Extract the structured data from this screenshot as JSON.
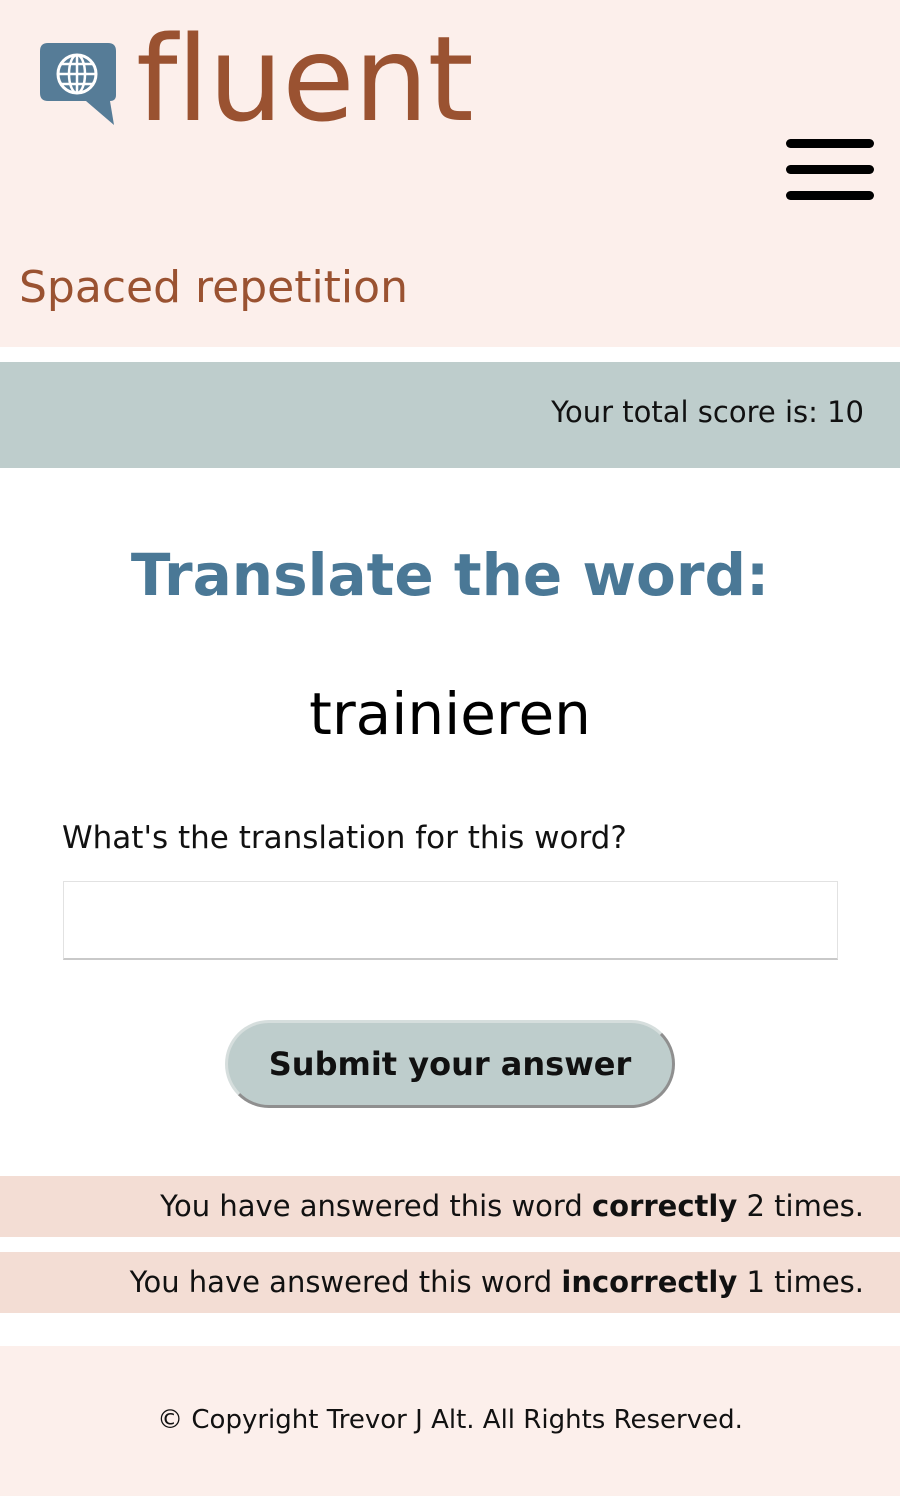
{
  "header": {
    "brand": "fluent",
    "page_subtitle": "Spaced repetition",
    "logo_icon": "globe-speech-bubble-icon",
    "menu_icon": "hamburger-menu-icon"
  },
  "score": {
    "text": "Your total score is: 10"
  },
  "quiz": {
    "heading": "Translate the word:",
    "word": "trainieren",
    "field_label": "What's the translation for this word?",
    "input_value": "",
    "submit_label": "Submit your answer"
  },
  "stats": {
    "correct_prefix": "You have answered this word",
    "correct_keyword": "correctly",
    "correct_suffix": "2 times.",
    "incorrect_prefix": "You have answered this word",
    "incorrect_keyword": "incorrectly",
    "incorrect_suffix": "1 times."
  },
  "footer": {
    "copyright": "© Copyright Trevor J Alt. All Rights Reserved."
  },
  "colors": {
    "header_bg": "#fcefeb",
    "brand": "#9a5231",
    "heading_blue": "#4a7896",
    "score_bar_bg": "#becdcc",
    "stat_bg": "#f3ddd4",
    "logo_blue": "#567c97"
  }
}
